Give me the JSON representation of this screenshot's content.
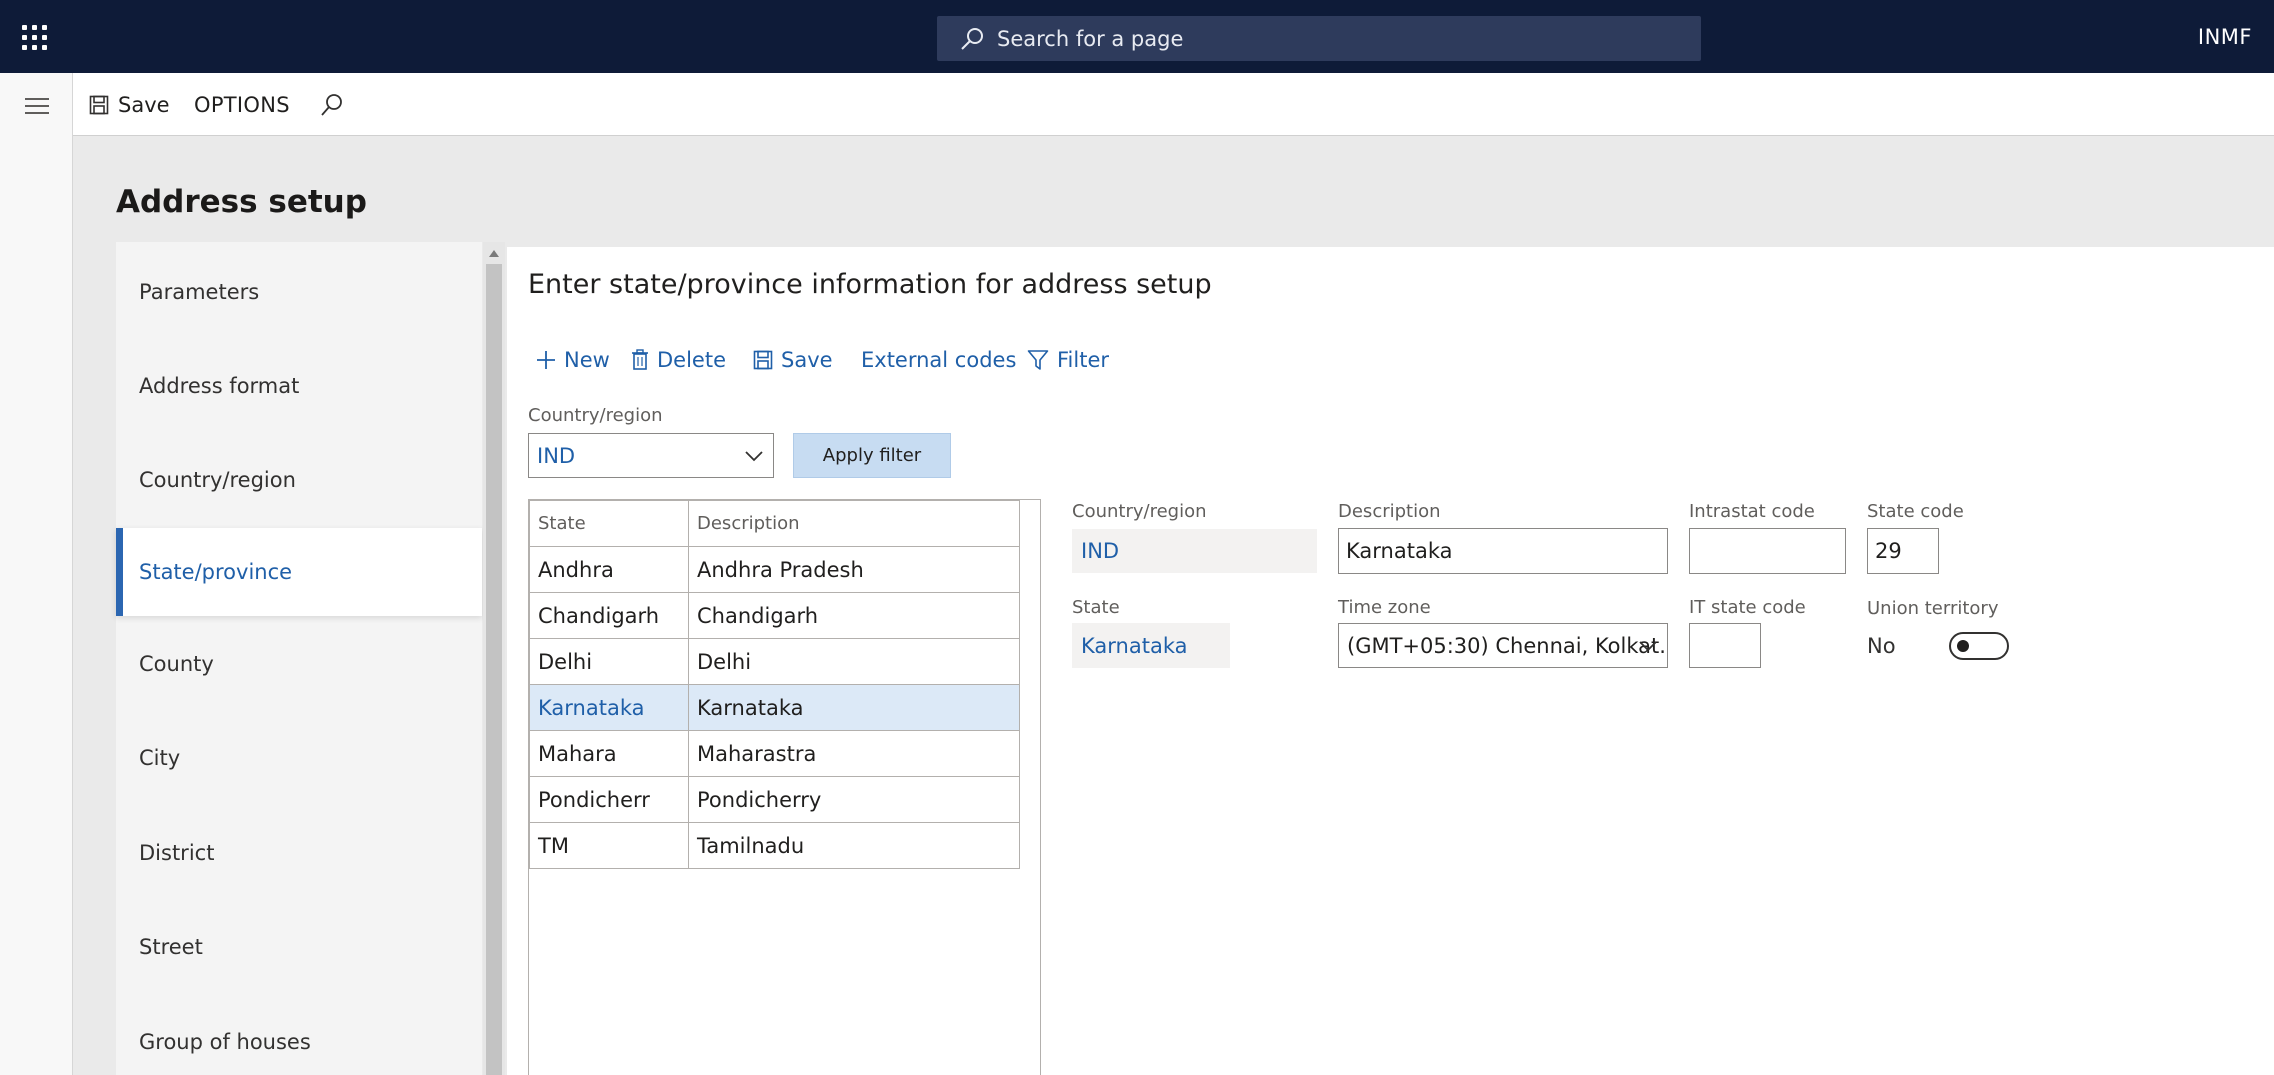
{
  "topbar": {
    "search_placeholder": "Search for a page",
    "company": "INMF"
  },
  "actionpane": {
    "save_label": "Save",
    "options_label": "OPTIONS"
  },
  "page": {
    "title": "Address setup"
  },
  "leftnav": {
    "items": [
      {
        "label": "Parameters"
      },
      {
        "label": "Address format"
      },
      {
        "label": "Country/region"
      },
      {
        "label": "State/province",
        "active": true
      },
      {
        "label": "County"
      },
      {
        "label": "City"
      },
      {
        "label": "District"
      },
      {
        "label": "Street"
      },
      {
        "label": "Group of houses"
      }
    ]
  },
  "main": {
    "section_title": "Enter state/province information for address setup",
    "toolbar": {
      "new_label": "New",
      "delete_label": "Delete",
      "save_label": "Save",
      "external_codes_label": "External codes",
      "filter_label": "Filter"
    },
    "filter": {
      "country_label": "Country/region",
      "country_value": "IND",
      "apply_label": "Apply filter"
    },
    "grid": {
      "headers": {
        "state": "State",
        "description": "Description"
      },
      "rows": [
        {
          "state": "Andhra",
          "description": "Andhra Pradesh"
        },
        {
          "state": "Chandigarh",
          "description": "Chandigarh"
        },
        {
          "state": "Delhi",
          "description": "Delhi"
        },
        {
          "state": "Karnataka",
          "description": "Karnataka",
          "selected": true
        },
        {
          "state": "Mahara",
          "description": "Maharastra"
        },
        {
          "state": "Pondicherr",
          "description": "Pondicherry"
        },
        {
          "state": "TM",
          "description": "Tamilnadu"
        }
      ]
    },
    "detail": {
      "country_label": "Country/region",
      "country_value": "IND",
      "description_label": "Description",
      "description_value": "Karnataka",
      "intrastat_label": "Intrastat code",
      "intrastat_value": "",
      "state_code_label": "State code",
      "state_code_value": "29",
      "state_label": "State",
      "state_value": "Karnataka",
      "timezone_label": "Time zone",
      "timezone_value": "(GMT+05:30) Chennai, Kolkat...",
      "it_state_code_label": "IT state code",
      "it_state_code_value": "",
      "union_territory_label": "Union territory",
      "union_territory_value": "No"
    }
  },
  "colors": {
    "topbar": "#0e1b38",
    "accent": "#1f5fa8",
    "selected_row": "#dce9f7",
    "apply_button": "#c7dcf2"
  }
}
